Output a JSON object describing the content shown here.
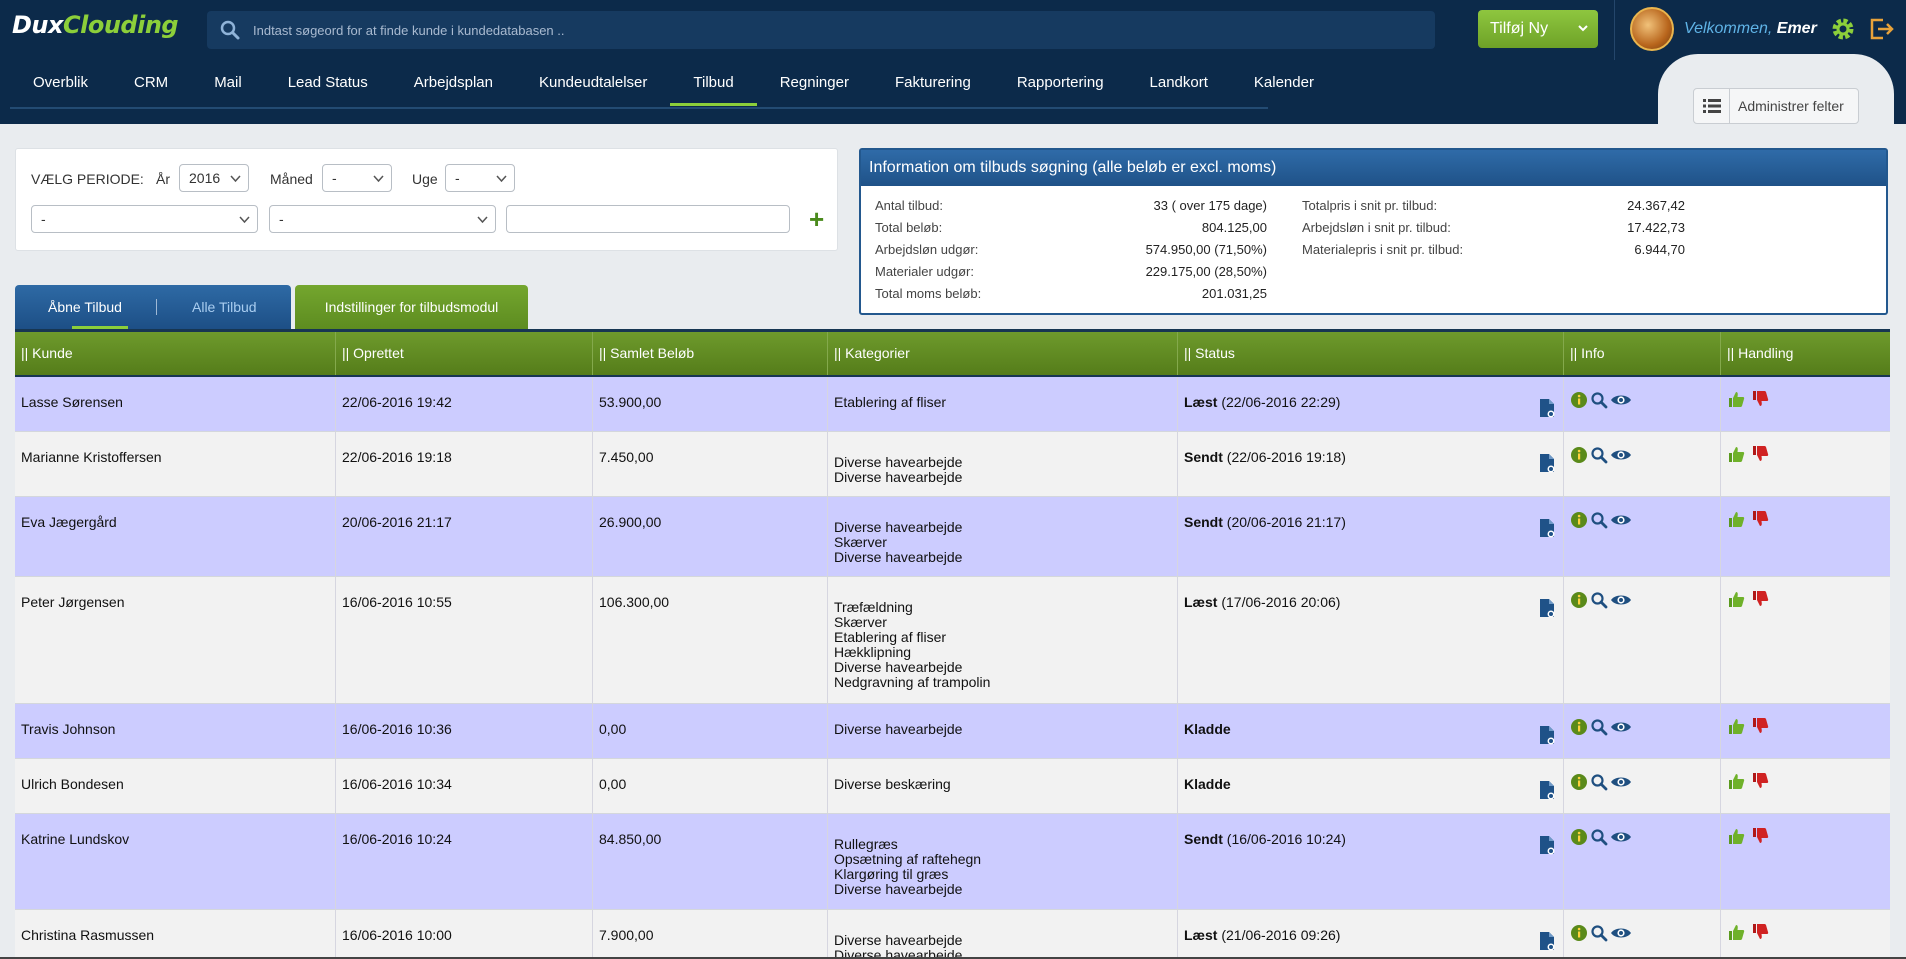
{
  "brand": {
    "part1": "Dux",
    "part2": "Clouding"
  },
  "search": {
    "placeholder": "Indtast søgeord for at finde kunde i kundedatabasen .."
  },
  "header": {
    "add_new_label": "Tilføj Ny",
    "welcome_prefix": "Velkommen,",
    "user_name": "Emer"
  },
  "nav": {
    "items": [
      "Overblik",
      "CRM",
      "Mail",
      "Lead Status",
      "Arbejdsplan",
      "Kundeudtalelser",
      "Tilbud",
      "Regninger",
      "Fakturering",
      "Rapportering",
      "Landkort",
      "Kalender"
    ],
    "active": "Tilbud"
  },
  "admin_fields_label": "Administrer felter",
  "filter": {
    "period_label": "VÆLG PERIODE:",
    "year_label": "År",
    "year_value": "2016",
    "month_label": "Måned",
    "month_value": "-",
    "week_label": "Uge",
    "week_value": "-",
    "select1_value": "-",
    "select2_value": "-",
    "text_value": "",
    "add_symbol": "+"
  },
  "tabs": {
    "open": "Åbne Tilbud",
    "all": "Alle Tilbud",
    "settings": "Indstillinger for tilbudsmodul"
  },
  "info": {
    "title": "Information om tilbuds søgning (alle beløb er excl. moms)",
    "left": [
      {
        "key": "Antal tilbud:",
        "value": "33 ( over 175 dage)"
      },
      {
        "key": "Total beløb:",
        "value": "804.125,00"
      },
      {
        "key": "Arbejdsløn udgør:",
        "value": "574.950,00 (71,50%)"
      },
      {
        "key": "Materialer udgør:",
        "value": "229.175,00 (28,50%)"
      },
      {
        "key": "Total moms beløb:",
        "value": "201.031,25"
      }
    ],
    "right": [
      {
        "key": "Totalpris i snit pr. tilbud:",
        "value": "24.367,42"
      },
      {
        "key": "Arbejdsløn i snit pr. tilbud:",
        "value": "17.422,73"
      },
      {
        "key": "Materialepris i snit pr. tilbud:",
        "value": "6.944,70"
      }
    ]
  },
  "table": {
    "columns": [
      "|| Kunde",
      "|| Oprettet",
      "|| Samlet Beløb",
      "|| Kategorier",
      "|| Status",
      "|| Info",
      "|| Handling"
    ],
    "rows": [
      {
        "kunde": "Lasse Sørensen",
        "oprettet": "22/06-2016 19:42",
        "belob": "53.900,00",
        "kategorier": [
          "Etablering af fliser"
        ],
        "status": "Læst",
        "status_date": "(22/06-2016 22:29)"
      },
      {
        "kunde": "Marianne Kristoffersen",
        "oprettet": "22/06-2016 19:18",
        "belob": "7.450,00",
        "kategorier": [
          "Diverse havearbejde",
          "Diverse havearbejde"
        ],
        "status": "Sendt",
        "status_date": "(22/06-2016 19:18)"
      },
      {
        "kunde": "Eva Jægergård",
        "oprettet": "20/06-2016 21:17",
        "belob": "26.900,00",
        "kategorier": [
          "Diverse havearbejde",
          "Skærver",
          "Diverse havearbejde"
        ],
        "status": "Sendt",
        "status_date": "(20/06-2016 21:17)"
      },
      {
        "kunde": "Peter Jørgensen",
        "oprettet": "16/06-2016 10:55",
        "belob": "106.300,00",
        "kategorier": [
          "Træfældning",
          "Skærver",
          "Etablering af fliser",
          "Hækklipning",
          "Diverse havearbejde",
          "Nedgravning af trampolin"
        ],
        "status": "Læst",
        "status_date": "(17/06-2016 20:06)"
      },
      {
        "kunde": "Travis Johnson",
        "oprettet": "16/06-2016 10:36",
        "belob": "0,00",
        "kategorier": [
          "Diverse havearbejde"
        ],
        "status": "Kladde",
        "status_date": ""
      },
      {
        "kunde": "Ulrich Bondesen",
        "oprettet": "16/06-2016 10:34",
        "belob": "0,00",
        "kategorier": [
          "Diverse beskæring"
        ],
        "status": "Kladde",
        "status_date": ""
      },
      {
        "kunde": "Katrine Lundskov",
        "oprettet": "16/06-2016 10:24",
        "belob": "84.850,00",
        "kategorier": [
          "Rullegræs",
          "Opsætning af raftehegn",
          "Klargøring til græs",
          "Diverse havearbejde"
        ],
        "status": "Sendt",
        "status_date": "(16/06-2016 10:24)"
      },
      {
        "kunde": "Christina Rasmussen",
        "oprettet": "16/06-2016 10:00",
        "belob": "7.900,00",
        "kategorier": [
          "Diverse havearbejde",
          "Diverse havearbejde"
        ],
        "status": "Læst",
        "status_date": "(21/06-2016 09:26)"
      }
    ]
  },
  "colors": {
    "navy": "#0c2a4a",
    "green": "#6ea227",
    "blue": "#1f5288",
    "row_odd": "#ccccff",
    "row_even": "#f2f2f2"
  },
  "icons": [
    "search-icon",
    "chevron-down-icon",
    "gear-icon",
    "logout-icon",
    "list-icon",
    "document-icon",
    "info-icon",
    "magnifier-icon",
    "eye-icon",
    "thumbs-up-icon",
    "thumbs-down-icon"
  ]
}
